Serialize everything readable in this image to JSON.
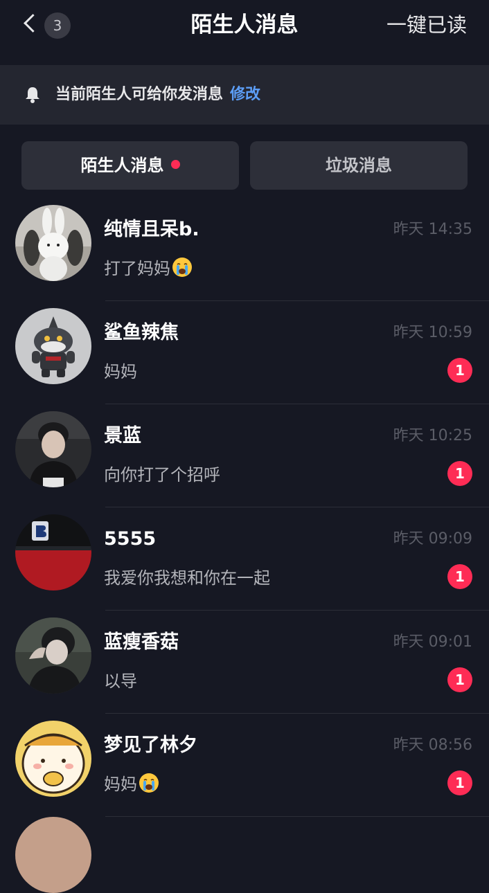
{
  "header": {
    "back_count": "3",
    "title": "陌生人消息",
    "mark_all_read": "一键已读"
  },
  "notice": {
    "text": "当前陌生人可给你发消息",
    "link": "修改"
  },
  "tabs": [
    {
      "label": "陌生人消息",
      "active": true,
      "has_dot": true
    },
    {
      "label": "垃圾消息",
      "active": false,
      "has_dot": false
    }
  ],
  "messages": [
    {
      "name": "纯情且呆b.",
      "time": "昨天 14:35",
      "preview": "打了妈妈",
      "emoji": "crying-face",
      "unread": ""
    },
    {
      "name": "鲨鱼辣焦",
      "time": "昨天 10:59",
      "preview": "妈妈",
      "emoji": "",
      "unread": "1"
    },
    {
      "name": "景蓝",
      "time": "昨天 10:25",
      "preview": "向你打了个招呼",
      "emoji": "",
      "unread": "1"
    },
    {
      "name": "5555",
      "time": "昨天 09:09",
      "preview": "我爱你我想和你在一起",
      "emoji": "",
      "unread": "1"
    },
    {
      "name": "蓝瘦香菇",
      "time": "昨天 09:01",
      "preview": "以导",
      "emoji": "",
      "unread": "1"
    },
    {
      "name": "梦见了林夕",
      "time": "昨天 08:56",
      "preview": "妈妈",
      "emoji": "crying-face",
      "unread": "1"
    }
  ],
  "colors": {
    "background": "#161823",
    "accent_red": "#fe2c55",
    "link_blue": "#5c9ef7"
  }
}
